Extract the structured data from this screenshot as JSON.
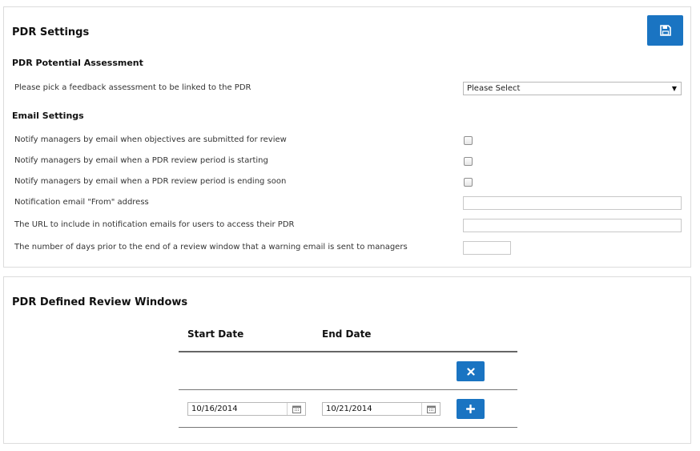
{
  "settings": {
    "title": "PDR Settings",
    "save_icon": "floppy-disk-icon",
    "assessment_section": "PDR Potential Assessment",
    "assessment_label": "Please pick a feedback assessment to be linked to the PDR",
    "assessment_selected": "Please Select",
    "email_section": "Email Settings",
    "notify_submitted": "Notify managers by email when objectives are submitted for review",
    "notify_starting": "Notify managers by email when a PDR review period is starting",
    "notify_ending": "Notify managers by email when a PDR review period is ending soon",
    "from_address_label": "Notification email \"From\" address",
    "from_address_value": "",
    "url_label": "The URL to include in notification emails for users to access their PDR",
    "url_value": "",
    "days_label": "The number of days prior to the end of a review window that a warning email is sent to managers",
    "days_value": ""
  },
  "windows": {
    "title": "PDR Defined Review Windows",
    "col_start": "Start Date",
    "col_end": "End Date",
    "new_start": "10/16/2014",
    "new_end": "10/21/2014"
  },
  "colors": {
    "accent": "#1a74c2",
    "border": "#dcdcdc"
  }
}
